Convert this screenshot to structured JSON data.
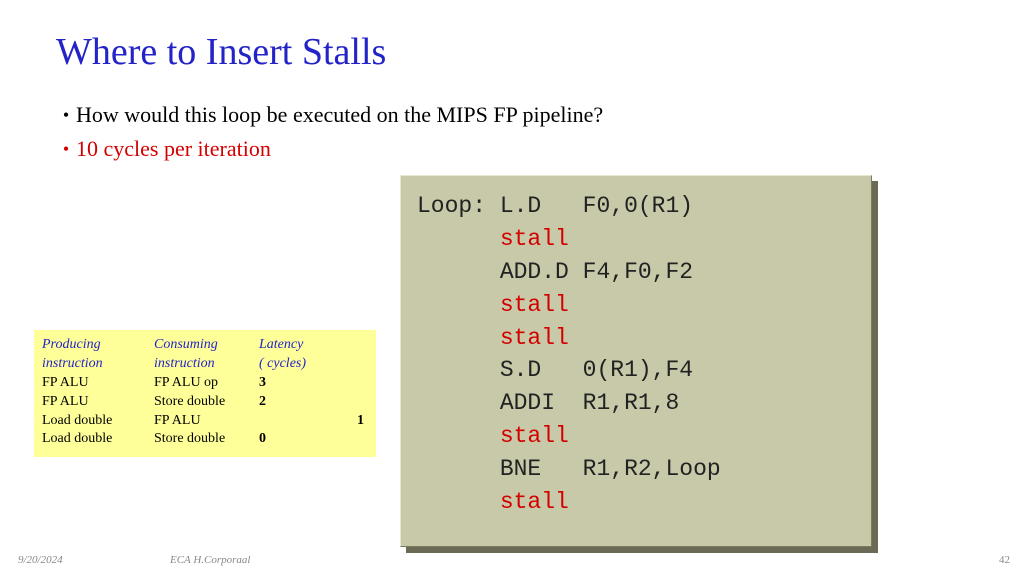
{
  "title": "Where to Insert Stalls",
  "bullets": [
    {
      "text": "How would this loop be executed on the MIPS FP pipeline?",
      "red": false
    },
    {
      "text": "10 cycles per iteration",
      "red": true
    }
  ],
  "latency_table": {
    "headers": {
      "c1": "Producing",
      "c1b": "instruction",
      "c2": "Consuming",
      "c2b": "instruction",
      "c3": "Latency",
      "c3b": "( cycles)"
    },
    "rows": [
      {
        "producing": "FP ALU",
        "consuming": "FP ALU op",
        "latency": "3",
        "far": false
      },
      {
        "producing": "FP ALU",
        "consuming": "Store double",
        "latency": "2",
        "far": false
      },
      {
        "producing": "Load double",
        "consuming": "FP ALU",
        "latency": "1",
        "far": true
      },
      {
        "producing": "Load double",
        "consuming": "Store double",
        "latency": "0",
        "far": false
      }
    ]
  },
  "code": [
    {
      "label": "Loop: ",
      "op": "L.D   ",
      "args": "F0,0(R1)",
      "stall": false
    },
    {
      "label": "      ",
      "op": "stall",
      "args": "",
      "stall": true
    },
    {
      "label": "      ",
      "op": "ADD.D ",
      "args": "F4,F0,F2",
      "stall": false
    },
    {
      "label": "      ",
      "op": "stall",
      "args": "",
      "stall": true
    },
    {
      "label": "      ",
      "op": "stall",
      "args": "",
      "stall": true
    },
    {
      "label": "      ",
      "op": "S.D   ",
      "args": "0(R1),F4",
      "stall": false
    },
    {
      "label": "      ",
      "op": "ADDI  ",
      "args": "R1,R1,8",
      "stall": false
    },
    {
      "label": "      ",
      "op": "stall",
      "args": "",
      "stall": true
    },
    {
      "label": "      ",
      "op": "BNE   ",
      "args": "R1,R2,Loop",
      "stall": false
    },
    {
      "label": "      ",
      "op": "stall",
      "args": "",
      "stall": true
    }
  ],
  "footer": {
    "date": "9/20/2024",
    "source": "ECA  H.Corporaal",
    "page": "42"
  }
}
